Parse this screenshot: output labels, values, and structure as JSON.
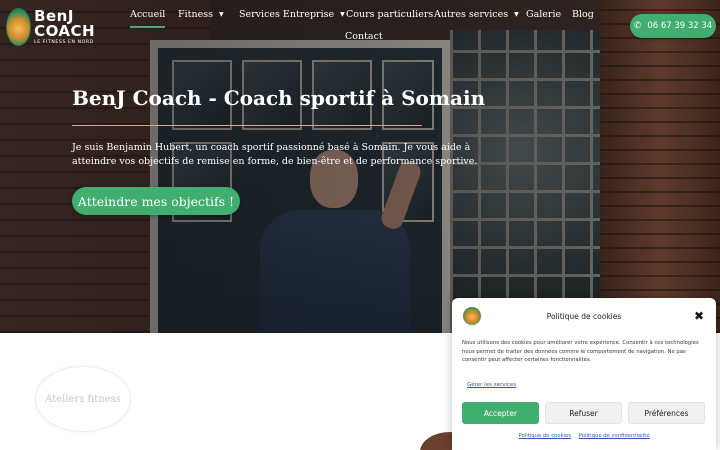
{
  "logo": {
    "brand": "BenJ COACH",
    "tagline": "LE FITNESS EN NORD"
  },
  "nav": {
    "items": [
      {
        "label": "Accueil",
        "active": true,
        "dropdown": false
      },
      {
        "label": "Fitness",
        "dropdown": true
      },
      {
        "label": "Services Entreprise",
        "dropdown": true
      },
      {
        "label": "Cours particuliers",
        "dropdown": false
      },
      {
        "label": "Autres services",
        "dropdown": true
      },
      {
        "label": "Galerie",
        "dropdown": false
      },
      {
        "label": "Blog",
        "dropdown": false
      },
      {
        "label": "Contact",
        "dropdown": false
      }
    ],
    "caret_glyph": "▼"
  },
  "phone": {
    "number": "06 67 39 32 34",
    "icon": "phone-icon"
  },
  "hero": {
    "title": "BenJ Coach - Coach sportif à Somain",
    "description": "Je suis Benjamin Hubert, un coach sportif passionné basé à Somain. Je vous aide à atteindre vos objectifs de remise en forme, de bien-être et de performance sportive.",
    "cta": "Atteindre mes objectifs !"
  },
  "section": {
    "atelier_label": "Ateliers fitness"
  },
  "cookie": {
    "title": "Politique de cookies",
    "close_glyph": "✖",
    "text": "Nous utilisons des cookies pour améliorer votre expérience. Consentir à ces technologies nous permet de traiter des données comme le comportement de navigation. Ne pas consentir peut affecter certaines fonctionnalités.",
    "manage": "Gérer les services",
    "accept": "Accepter",
    "refuse": "Refuser",
    "preferences": "Préférences",
    "link_cookies": "Politique de cookies",
    "link_privacy": "Politique de confidentialité"
  },
  "colors": {
    "accent": "#3fae6e",
    "brown": "#6b3f2e",
    "link": "#2a5fa8"
  }
}
